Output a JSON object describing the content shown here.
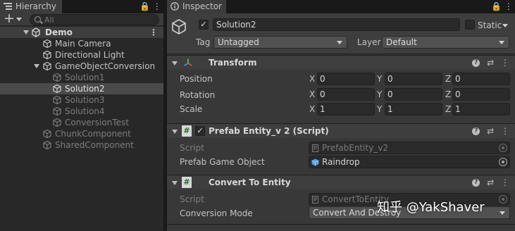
{
  "hierarchy": {
    "tab_label": "Hierarchy",
    "search_placeholder": "All",
    "tools": "🔒 ⋮",
    "scene_name": "Demo",
    "items": [
      {
        "label": "Main Camera",
        "dim": false
      },
      {
        "label": "Directional Light",
        "dim": false
      },
      {
        "label": "GameObjectConversion",
        "dim": false
      },
      {
        "label": "Solution1",
        "dim": true
      },
      {
        "label": "Solution2",
        "dim": false
      },
      {
        "label": "Solution3",
        "dim": true
      },
      {
        "label": "Solution4",
        "dim": true
      },
      {
        "label": "ConversionTest",
        "dim": true
      },
      {
        "label": "ChunkComponent",
        "dim": true
      },
      {
        "label": "SharedComponent",
        "dim": true
      }
    ]
  },
  "inspector": {
    "tab_label": "Inspector",
    "tools": "🔒 ⋮",
    "object_name": "Solution2",
    "active_check": "✓",
    "static_label": "Static",
    "tag_label": "Tag",
    "tag_value": "Untagged",
    "layer_label": "Layer",
    "layer_value": "Default",
    "transform": {
      "title": "Transform",
      "rows": [
        {
          "label": "Position",
          "x": "0",
          "y": "0",
          "z": "0"
        },
        {
          "label": "Rotation",
          "x": "0",
          "y": "0",
          "z": "0"
        },
        {
          "label": "Scale",
          "x": "1",
          "y": "1",
          "z": "1"
        }
      ],
      "axis_x": "X",
      "axis_y": "Y",
      "axis_z": "Z"
    },
    "prefab_entity": {
      "title": "Prefab Entity_v 2 (Script)",
      "script_label": "Script",
      "script_value": "PrefabEntity_v2",
      "prefab_label": "Prefab Game Object",
      "prefab_value": "Raindrop"
    },
    "convert_to_entity": {
      "title": "Convert To Entity",
      "script_label": "Script",
      "script_value": "ConvertToEntity",
      "mode_label": "Conversion Mode",
      "mode_value": "Convert And Destroy"
    },
    "component_tools": "⇄ ⋮",
    "help_glyph": "?",
    "script_glyph": "#"
  },
  "watermark": "知乎 @YakShaver",
  "colors": {
    "selected_row": "#4a4a4a",
    "panel_bg": "#383838",
    "hierarchy_bg": "#282828",
    "transform_icon_red": "#e84b3c",
    "transform_icon_green": "#6fc46f",
    "transform_icon_blue": "#4a8fe0",
    "prefab_icon": "#4fa3e8"
  }
}
